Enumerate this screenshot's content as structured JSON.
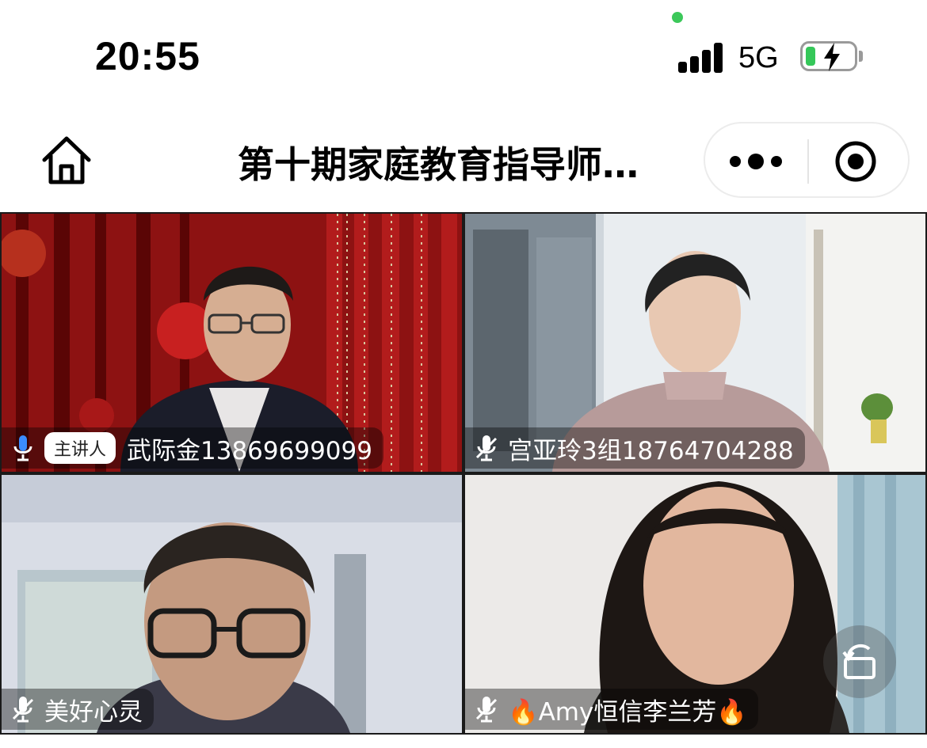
{
  "status_bar": {
    "time": "20:55",
    "network": "5G",
    "battery_level": 0.2,
    "charging": true,
    "colors": {
      "battery": "#35c759",
      "indicator_dot": "#3cc85a"
    }
  },
  "nav": {
    "title": "第十期家庭教育指导师…",
    "home_icon": "home-icon",
    "more_icon": "more-dots-icon",
    "close_icon": "target-close-icon"
  },
  "participants": [
    {
      "name": "武际金13869699099",
      "role_badge": "主讲人",
      "mic": "active"
    },
    {
      "name": "宫亚玲3组18764704288",
      "mic": "muted"
    },
    {
      "name": "美好心灵",
      "mic": "muted"
    },
    {
      "name": "🔥Amy恒信李兰芳🔥",
      "mic": "muted"
    }
  ],
  "controls": {
    "rotate_icon": "rotate-screen-icon"
  }
}
